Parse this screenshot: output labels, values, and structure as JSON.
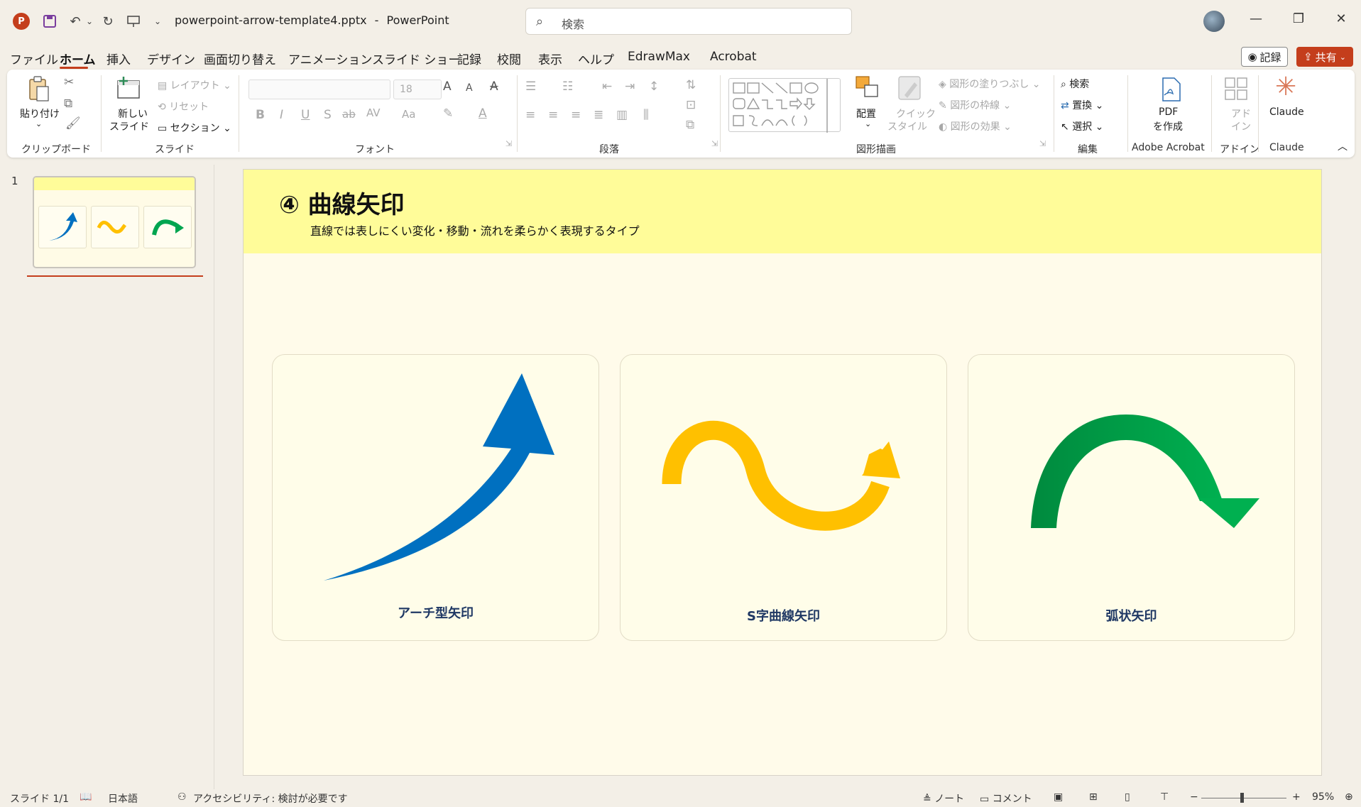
{
  "titlebar": {
    "file_name": "powerpoint-arrow-template4.pptx",
    "separator": "-",
    "app_name": "PowerPoint",
    "search_placeholder": "検索",
    "undo_chevron": "⌄",
    "qat_chevron": "⌄",
    "minimize": "—",
    "restore": "❐",
    "close": "✕"
  },
  "menu": {
    "tabs": [
      {
        "label": "ファイル",
        "active": false
      },
      {
        "label": "ホーム",
        "active": true
      },
      {
        "label": "挿入",
        "active": false
      },
      {
        "label": "デザイン",
        "active": false
      },
      {
        "label": "画面切り替え",
        "active": false
      },
      {
        "label": "アニメーション",
        "active": false
      },
      {
        "label": "スライド ショー",
        "active": false
      },
      {
        "label": "記録",
        "active": false
      },
      {
        "label": "校閲",
        "active": false
      },
      {
        "label": "表示",
        "active": false
      },
      {
        "label": "ヘルプ",
        "active": false
      },
      {
        "label": "EdrawMax",
        "active": false
      },
      {
        "label": "Acrobat",
        "active": false
      }
    ],
    "record_button": "記録",
    "share_button": "共有"
  },
  "ribbon": {
    "clipboard": {
      "paste": "貼り付け",
      "group": "クリップボード"
    },
    "slides": {
      "new_slide_1": "新しい",
      "new_slide_2": "スライド",
      "layout": "レイアウト",
      "reset": "リセット",
      "section": "セクション",
      "group": "スライド"
    },
    "font": {
      "font_name": "",
      "font_size": "18",
      "bold": "B",
      "italic": "I",
      "underline": "U",
      "shadow": "S",
      "strike": "ab",
      "spacing": "AV",
      "case": "Aa",
      "grow": "A",
      "shrink": "A",
      "clear": "A",
      "highlight": "✎",
      "font_color": "A",
      "group": "フォント"
    },
    "paragraph": {
      "group": "段落"
    },
    "drawing": {
      "arrange": "配置",
      "quick_style_1": "クイック",
      "quick_style_2": "スタイル",
      "fill": "図形の塗りつぶし",
      "outline": "図形の枠線",
      "effects": "図形の効果",
      "group": "図形描画"
    },
    "editing": {
      "find": "検索",
      "replace": "置換",
      "select": "選択",
      "group": "編集"
    },
    "acrobat": {
      "pdf_1": "PDF",
      "pdf_2": "を作成",
      "group": "Adobe Acrobat"
    },
    "addins": {
      "label_1": "アド",
      "label_2": "イン",
      "group": "アドイン"
    },
    "claude": {
      "label": "Claude",
      "group": "Claude"
    }
  },
  "thumbnails": {
    "slide_number": "1"
  },
  "slide": {
    "title": "④ 曲線矢印",
    "subtitle": "直線では表しにくい変化・移動・流れを柔らかく表現するタイプ",
    "cards": [
      {
        "label": "アーチ型矢印",
        "color": "#0070c0"
      },
      {
        "label": "S字曲線矢印",
        "color": "#ffc000"
      },
      {
        "label": "弧状矢印",
        "color": "#00b050"
      }
    ]
  },
  "statusbar": {
    "slide_indicator": "スライド 1/1",
    "language": "日本語",
    "accessibility": "アクセシビリティ: 検討が必要です",
    "notes": "ノート",
    "comments": "コメント",
    "zoom_minus": "−",
    "zoom_plus": "+",
    "zoom": "95%"
  },
  "colors": {
    "accent": "#c43e1c",
    "header_yellow": "#fffc99",
    "slide_bg": "#fffbea",
    "label_navy": "#1f3864"
  }
}
